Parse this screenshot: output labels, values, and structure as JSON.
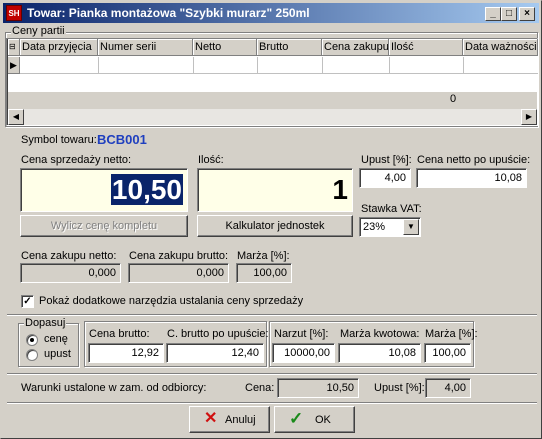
{
  "window": {
    "title": "Towar: Pianka montażowa \"Szybki murarz\" 250ml",
    "app_icon_text": "SH",
    "min": "_",
    "max": "□",
    "close": "×"
  },
  "batches": {
    "group_label": "Ceny partii",
    "columns": [
      "Data przyjęcia",
      "Numer serii",
      "Netto",
      "Brutto",
      "Cena zakupu",
      "Ilość",
      "Data ważności"
    ],
    "footer_total": "0"
  },
  "product": {
    "symbol_label": "Symbol towaru:",
    "symbol_value": "BCB001"
  },
  "price": {
    "net_label": "Cena sprzedaży netto:",
    "net_value": "10,50",
    "qty_label": "Ilość:",
    "qty_value": "1",
    "discount_label": "Upust [%]:",
    "discount_value": "4,00",
    "net_after_discount_label": "Cena netto po upuście:",
    "net_after_discount_value": "10,08",
    "vat_label": "Stawka VAT:",
    "vat_value": "23%",
    "calc_set_price_button": "Wylicz cenę kompletu",
    "unit_calc_button": "Kalkulator jednostek"
  },
  "purchase": {
    "net_label": "Cena zakupu netto:",
    "net_value": "0,000",
    "gross_label": "Cena zakupu brutto:",
    "gross_value": "0,000",
    "margin_label": "Marża [%]:",
    "margin_value": "100,00"
  },
  "extra_tools": {
    "label": "Pokaż dodatkowe narzędzia ustalania ceny sprzedaży",
    "checked": true
  },
  "adjust": {
    "group_label": "Dopasuj",
    "option_price": "cenę",
    "option_discount": "upust",
    "selected": "cenę"
  },
  "gross": {
    "gross_label": "Cena brutto:",
    "gross_value": "12,92",
    "gross_after_label": "C. brutto po upuście:",
    "gross_after_value": "12,40"
  },
  "markup": {
    "markup_label": "Narzut [%]:",
    "markup_value": "10000,00",
    "margin_amount_label": "Marża kwotowa:",
    "margin_amount_value": "10,08",
    "margin_pct_label": "Marża [%]:",
    "margin_pct_value": "100,00"
  },
  "terms": {
    "label": "Warunki ustalone w zam. od odbiorcy:",
    "price_label": "Cena:",
    "price_value": "10,50",
    "discount_label": "Upust [%]:",
    "discount_value": "4,00"
  },
  "buttons": {
    "cancel": "Anuluj",
    "ok": "OK"
  },
  "colors": {
    "symbol": "#1f3fbf",
    "title_start": "#0a246a",
    "big_field_bg": "#ffffe8",
    "selection": "#0a246a",
    "cancel_icon": "#d01010",
    "ok_icon": "#1a8a1a"
  }
}
